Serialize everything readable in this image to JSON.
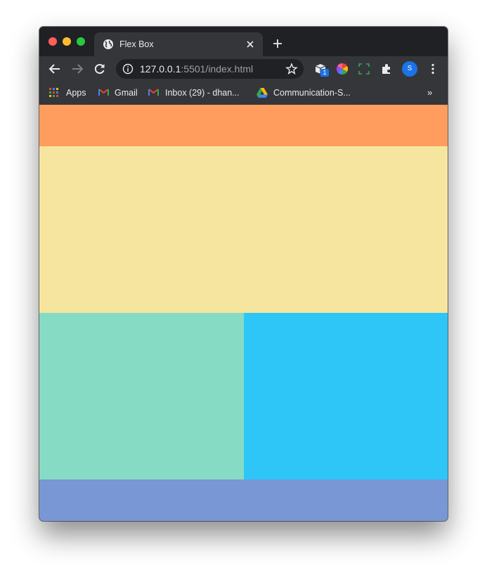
{
  "browser": {
    "tab_title": "Flex Box",
    "url_host": "127.0.0.1",
    "url_rest": ":5501/index.html",
    "extension_badge": "1",
    "profile_initial": "S"
  },
  "bookmarks": [
    {
      "label": "Apps",
      "icon": "apps-grid-icon"
    },
    {
      "label": "Gmail",
      "icon": "gmail-icon"
    },
    {
      "label": "Inbox (29) - dhan...",
      "icon": "gmail-icon"
    },
    {
      "label": "Communication-S...",
      "icon": "google-drive-icon"
    }
  ],
  "bookmarks_overflow": "»",
  "page": {
    "blocks": [
      {
        "name": "header-block",
        "color": "#ff9d5f"
      },
      {
        "name": "main-block",
        "color": "#f6e59f"
      },
      {
        "name": "left-block",
        "color": "#86dbc5"
      },
      {
        "name": "right-block",
        "color": "#2ec6f6"
      },
      {
        "name": "footer-block",
        "color": "#7997d4"
      }
    ]
  }
}
